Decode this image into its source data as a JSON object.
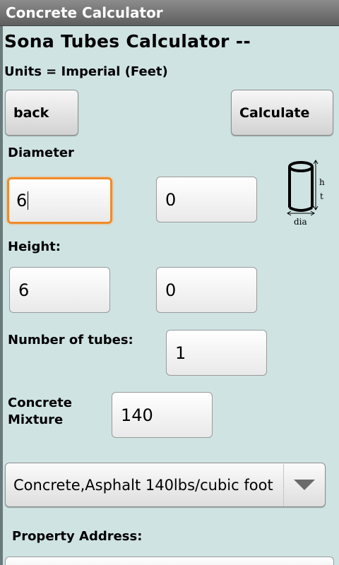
{
  "app": {
    "title": "Concrete Calculator"
  },
  "page": {
    "title": "Sona Tubes Calculator --",
    "units": "Units = Imperial (Feet)"
  },
  "buttons": {
    "back": "back",
    "calculate": "Calculate"
  },
  "diameter": {
    "label": "Diameter",
    "feet": "6",
    "inches": "0"
  },
  "height": {
    "label": "Height:",
    "feet": "6",
    "inches": "0"
  },
  "tubes": {
    "label": "Number of tubes:",
    "value": "1"
  },
  "mixture": {
    "label_line1": "Concrete",
    "label_line2": "Mixture",
    "value": "140"
  },
  "spinner": {
    "selected": "Concrete,Asphalt 140lbs/cubic foot"
  },
  "address": {
    "label": "Property Address:"
  },
  "icon": {
    "name": "tube-dimensions-icon",
    "labels": {
      "height": "h t",
      "diameter": "dia"
    }
  },
  "colors": {
    "focus": "#f08b2a",
    "background": "#cfe3e3"
  }
}
